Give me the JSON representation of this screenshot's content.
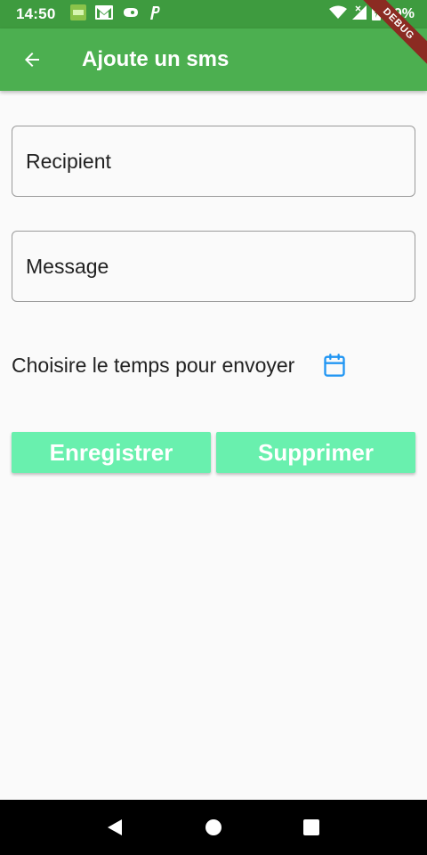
{
  "status_bar": {
    "time": "14:50",
    "battery": "99%",
    "icons": [
      "app-notification-icon",
      "gmail-icon",
      "game-controller-icon",
      "parking-icon",
      "wifi-icon",
      "signal-icon",
      "battery-icon"
    ]
  },
  "app_bar": {
    "title": "Ajoute un sms",
    "debug_label": "DEBUG"
  },
  "form": {
    "recipient_placeholder": "Recipient",
    "message_placeholder": "Message",
    "time_label": "Choisire le temps pour envoyer"
  },
  "buttons": {
    "save_label": "Enregistrer",
    "delete_label": "Supprimer"
  },
  "colors": {
    "app_bar": "#4caf50",
    "status_bar": "#3e9b3f",
    "button": "#69f0ae",
    "calendar_icon": "#2196f3"
  }
}
